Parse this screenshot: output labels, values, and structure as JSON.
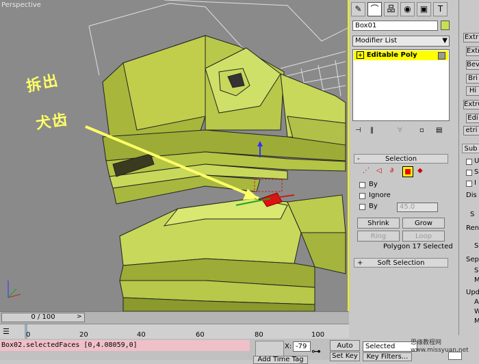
{
  "viewport": {
    "label": "Perspective",
    "annotation_line1": "拆出",
    "annotation_line2": "犬齿"
  },
  "command_panel": {
    "tabs": [
      "create-icon",
      "modify-icon",
      "hierarchy-icon",
      "motion-icon",
      "display-icon",
      "utilities-icon"
    ],
    "object_name": "Box01",
    "object_color": "#c8e050",
    "modifier_list_label": "Modifier List",
    "stack_item": "Editable Poly",
    "selection": {
      "title": "Selection",
      "by_vertex": "By",
      "ignore_backfacing": "Ignore",
      "by_angle": "By",
      "angle_value": "45.0",
      "shrink": "Shrink",
      "grow": "Grow",
      "ring": "Ring",
      "loop": "Loop",
      "status": "Polygon 17 Selected"
    },
    "soft_selection_title": "Soft Selection"
  },
  "side_panel": {
    "buttons": [
      "Extr",
      "Bev",
      "Bri",
      "Hi",
      "Extru",
      "Edi",
      "etri"
    ],
    "sub_title": "Sub",
    "labels": [
      "U",
      "S",
      "I",
      "Dis",
      "S",
      "Ren",
      "S",
      "Sep",
      "S",
      "M",
      "Upd",
      "A",
      "W",
      "M"
    ]
  },
  "timeline": {
    "frame_display": "0 / 100",
    "ticks": [
      "0",
      "20",
      "40",
      "60",
      "80",
      "100"
    ]
  },
  "status": {
    "script_text": "Box02.selectedFaces [0,4.08059,0]",
    "x_label": "X:",
    "x_value": "-79",
    "auto_key": "Auto Key",
    "set_key": "Set Key",
    "selected": "Selected",
    "key_filters": "Key Filters...",
    "add_time_tag": "Add Time Tag",
    "watermark": "思缘教程网 www.missyuan.net"
  }
}
